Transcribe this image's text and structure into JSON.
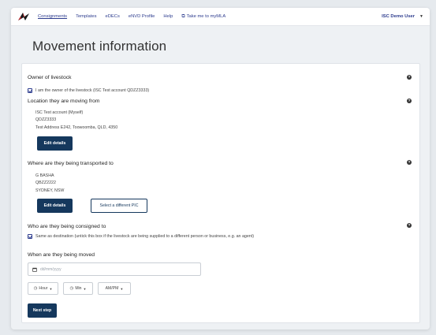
{
  "nav": {
    "items": [
      {
        "label": "Consignments",
        "active": true
      },
      {
        "label": "Templates"
      },
      {
        "label": "eDECs"
      },
      {
        "label": "eNVD Profile"
      },
      {
        "label": "Help"
      }
    ],
    "external_link": {
      "icon": "external-link-icon",
      "label": "Take me to myMLA"
    },
    "user": {
      "label": "ISC Demo User",
      "icon": "caret-down-icon"
    }
  },
  "page": {
    "title": "Movement information"
  },
  "owner": {
    "heading": "Owner of livestock",
    "checkbox_label": "I am the owner of the livestock (ISC Test account QDZZ3333)",
    "checked": true
  },
  "from": {
    "heading": "Location they are moving from",
    "name": "ISC Test account (Myself)",
    "pic": "QDZZ3333",
    "address": "Test Address E242, Toowoomba, QLD, 4350",
    "edit_label": "Edit details"
  },
  "to": {
    "heading": "Where are they being transported to",
    "name": "G BASHA",
    "pic": "QBZZ2222",
    "address": "SYDNEY, NSW",
    "edit_label": "Edit details",
    "select_pic_label": "Select a different PIC"
  },
  "consigned": {
    "heading": "Who are they being consigned to",
    "checkbox_label": "Same as destination (untick this box if the livestock are being supplied to a different person or business, e.g. an agent)",
    "checked": true
  },
  "when": {
    "heading": "When are they being moved",
    "date_placeholder": "dd/mm/yyyy",
    "hour_label": "Hour",
    "min_label": "Min",
    "ampm_label": "AM/PM"
  },
  "actions": {
    "next_label": "Next step"
  },
  "icons": {
    "help": "help-icon",
    "calendar": "calendar-icon",
    "clock": "clock-icon",
    "chevron": "chevron-down-icon"
  },
  "colors": {
    "primary": "#15385d",
    "nav_link": "#2d3c8e",
    "background": "#eef1f4"
  }
}
